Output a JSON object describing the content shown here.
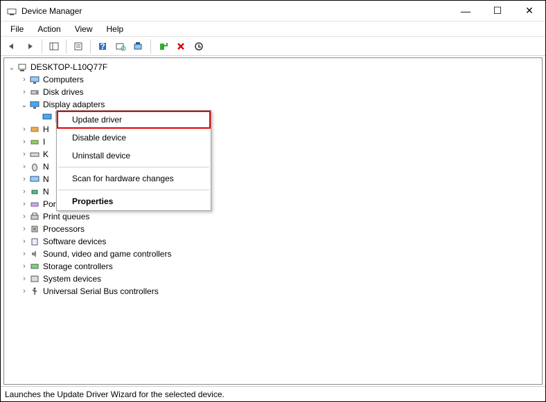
{
  "window": {
    "title": "Device Manager",
    "controls": {
      "min": "—",
      "max": "☐",
      "close": "✕"
    }
  },
  "menubar": [
    "File",
    "Action",
    "View",
    "Help"
  ],
  "tree": {
    "root": "DESKTOP-L10Q77F",
    "items": [
      {
        "label": "Computers",
        "expanded": false
      },
      {
        "label": "Disk drives",
        "expanded": false
      },
      {
        "label": "Display adapters",
        "expanded": true,
        "selectedChild": true
      },
      {
        "label": "H",
        "obscured": true
      },
      {
        "label": "I",
        "obscured": true
      },
      {
        "label": "K",
        "obscured": true
      },
      {
        "label": "N",
        "obscured": true
      },
      {
        "label": "N",
        "obscured": true
      },
      {
        "label": "N",
        "obscured": true
      },
      {
        "label": "Ports (COM & LPT)",
        "obscured": true
      },
      {
        "label": "Print queues",
        "expanded": false
      },
      {
        "label": "Processors",
        "expanded": false
      },
      {
        "label": "Software devices",
        "expanded": false
      },
      {
        "label": "Sound, video and game controllers",
        "expanded": false
      },
      {
        "label": "Storage controllers",
        "expanded": false
      },
      {
        "label": "System devices",
        "expanded": false
      },
      {
        "label": "Universal Serial Bus controllers",
        "expanded": false
      }
    ]
  },
  "context_menu": {
    "items": [
      {
        "label": "Update driver",
        "highlighted": true
      },
      {
        "label": "Disable device"
      },
      {
        "label": "Uninstall device"
      },
      {
        "sep": true
      },
      {
        "label": "Scan for hardware changes"
      },
      {
        "sep": true
      },
      {
        "label": "Properties",
        "bold": true
      }
    ]
  },
  "statusbar": "Launches the Update Driver Wizard for the selected device."
}
